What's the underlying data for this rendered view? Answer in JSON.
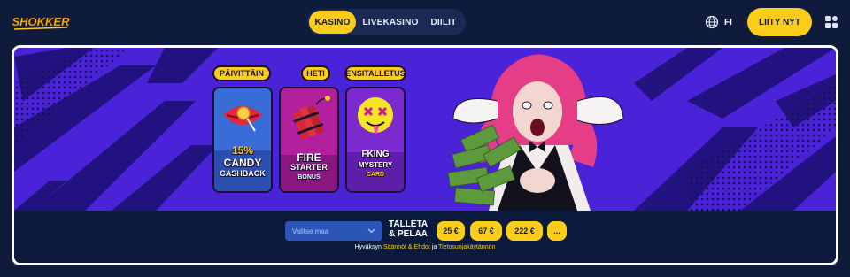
{
  "header": {
    "logo_text": "SHOKKER",
    "nav": [
      {
        "label": "KASINO",
        "active": true
      },
      {
        "label": "LIVEKASINO",
        "active": false
      },
      {
        "label": "DIILIT",
        "active": false
      }
    ],
    "language": "FI",
    "join_label": "LIITY NYT"
  },
  "promos": [
    {
      "tag": "PÄIVITTÄIN",
      "line1": "15%",
      "line2": "CANDY",
      "line3": "CASHBACK",
      "icon": "lips-lollipop-icon"
    },
    {
      "tag": "HETI",
      "line1": "FIRE",
      "line2": "STARTER",
      "line3": "BONUS",
      "icon": "dynamite-icon"
    },
    {
      "tag": "ENSITALLETUS",
      "line1": "FKING",
      "line2": "MYSTERY",
      "line3": "CARD",
      "icon": "dizzy-smiley-icon"
    }
  ],
  "deposit": {
    "select_placeholder": "Valitse maa",
    "talleta_line1": "TALLETA",
    "talleta_line2": "& PELAA",
    "amounts": [
      "25 €",
      "67 €",
      "222 €",
      "..."
    ],
    "terms_prefix": "Hyväksyn",
    "terms_link1": "Säännöt & Ehdot",
    "terms_mid": "ja",
    "terms_link2": "Tietosuojakäytännön"
  },
  "colors": {
    "background": "#0f1b3b",
    "accent": "#fccc1a",
    "hero_purple": "#4a22d8",
    "select_blue": "#2c55b8"
  }
}
